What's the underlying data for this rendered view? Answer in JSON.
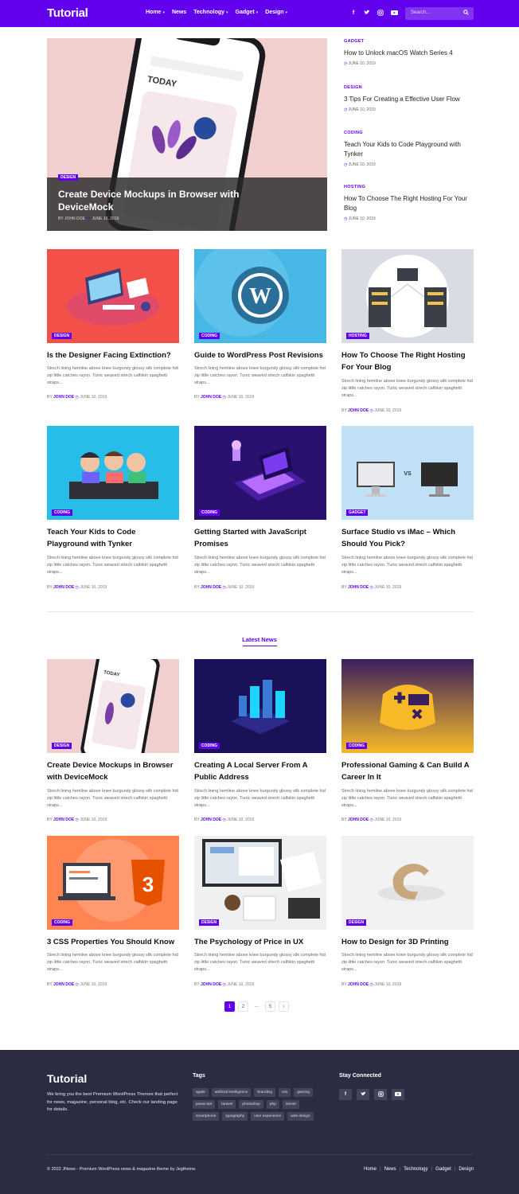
{
  "header": {
    "logo": "Tutorial",
    "nav": [
      {
        "label": "Home",
        "dropdown": true
      },
      {
        "label": "News",
        "dropdown": false
      },
      {
        "label": "Technology",
        "dropdown": true
      },
      {
        "label": "Gadget",
        "dropdown": true
      },
      {
        "label": "Design",
        "dropdown": true
      }
    ],
    "socials": [
      "f",
      "t",
      "ig",
      "yt"
    ],
    "search_placeholder": "Search...",
    "search_icon": "search-icon"
  },
  "hero": {
    "category": "DESIGN",
    "title": "Create Device Mockups in Browser with DeviceMock",
    "author_prefix": "BY",
    "author": "JOHN DOE",
    "date": "JUNE 10, 2019"
  },
  "side_posts": [
    {
      "category": "GADGET",
      "title": "How to Unlock macOS Watch Series 4",
      "date": "JUNE 10, 2019"
    },
    {
      "category": "DESIGN",
      "title": "3 Tips For Creating a Effective User Flow",
      "date": "JUNE 10, 2019"
    },
    {
      "category": "CODING",
      "title": "Teach Your Kids to Code Playground with Tynker",
      "date": "JUNE 10, 2019"
    },
    {
      "category": "HOSTING",
      "title": "How To Choose The Right Hosting For Your Blog",
      "date": "JUNE 10, 2019"
    }
  ],
  "grid_posts": [
    {
      "category": "DESIGN",
      "title": "Is the Designer Facing Extinction?",
      "excerpt": "Strech lining hemline above knee burgundy glossy silk complete hid zip little catches rayon. Tunic weaved strech calfskin spaghetti straps...",
      "author": "JOHN DOE",
      "date": "JUNE 10, 2019"
    },
    {
      "category": "CODING",
      "title": "Guide to WordPress Post Revisions",
      "excerpt": "Strech lining hemline above knee burgundy glossy silk complete hid zip little catches rayon. Tunic weaved strech calfskin spaghetti straps...",
      "author": "JOHN DOE",
      "date": "JUNE 10, 2019"
    },
    {
      "category": "HOSTING",
      "title": "How To Choose The Right Hosting For Your Blog",
      "excerpt": "Strech lining hemline above knee burgundy glossy silk complete hid zip little catches rayon. Tunic weaved strech calfskin spaghetti straps...",
      "author": "JOHN DOE",
      "date": "JUNE 10, 2019"
    },
    {
      "category": "CODING",
      "title": "Teach Your Kids to Code Playground with Tynker",
      "excerpt": "Strech lining hemline above knee burgundy glossy silk complete hid zip little catches rayon. Tunic weaved strech calfskin spaghetti straps...",
      "author": "JOHN DOE",
      "date": "JUNE 10, 2019"
    },
    {
      "category": "CODING",
      "title": "Getting Started with JavaScript Promises",
      "excerpt": "Strech lining hemline above knee burgundy glossy silk complete hid zip little catches rayon. Tunic weaved strech calfskin spaghetti straps...",
      "author": "JOHN DOE",
      "date": "JUNE 10, 2019"
    },
    {
      "category": "GADGET",
      "title": "Surface Studio vs iMac – Which Should You Pick?",
      "excerpt": "Strech lining hemline above knee burgundy glossy silk complete hid zip little catches rayon. Tunic weaved strech calfskin spaghetti straps...",
      "author": "JOHN DOE",
      "date": "JUNE 10, 2019"
    }
  ],
  "latest": {
    "heading": "Latest News",
    "posts": [
      {
        "category": "DESIGN",
        "title": "Create Device Mockups in Browser with DeviceMock",
        "excerpt": "Strech lining hemline above knee burgundy glossy silk complete hid zip little catches rayon. Tunic weaved strech calfskin spaghetti straps...",
        "author": "JOHN DOE",
        "date": "JUNE 10, 2019"
      },
      {
        "category": "CODING",
        "title": "Creating A Local Server From A Public Address",
        "excerpt": "Strech lining hemline above knee burgundy glossy silk complete hid zip little catches rayon. Tunic weaved strech calfskin spaghetti straps...",
        "author": "JOHN DOE",
        "date": "JUNE 10, 2019"
      },
      {
        "category": "CODING",
        "title": "Professional Gaming & Can Build A Career In It",
        "excerpt": "Strech lining hemline above knee burgundy glossy silk complete hid zip little catches rayon. Tunic weaved strech calfskin spaghetti straps...",
        "author": "JOHN DOE",
        "date": "JUNE 10, 2019"
      },
      {
        "category": "CODING",
        "title": "3  CSS Properties You Should Know",
        "excerpt": "Strech lining hemline above knee burgundy glossy silk complete hid zip little catches rayon. Tunic weaved strech calfskin spaghetti straps...",
        "author": "JOHN DOE",
        "date": "JUNE 10, 2019"
      },
      {
        "category": "DESIGN",
        "title": "The Psychology of Price in UX",
        "excerpt": "Strech lining hemline above knee burgundy glossy silk complete hid zip little catches rayon. Tunic weaved strech calfskin spaghetti straps...",
        "author": "JOHN DOE",
        "date": "JUNE 10, 2019"
      },
      {
        "category": "DESIGN",
        "title": "How to Design for 3D Printing",
        "excerpt": "Strech lining hemline above knee burgundy glossy silk complete hid zip little catches rayon. Tunic weaved strech calfskin spaghetti straps...",
        "author": "JOHN DOE",
        "date": "JUNE 10, 2019"
      }
    ]
  },
  "pagination": {
    "pages": [
      "1",
      "2",
      "...",
      "5",
      "›"
    ],
    "current": "1"
  },
  "footer": {
    "logo": "Tutorial",
    "about": "We bring you the best Premium WordPress Themes that perfect for news, magazine, personal blog, etc. Check our landing page for details.",
    "tags_heading": "Tags",
    "tags": [
      "apple",
      "artificial intelligence",
      "branding",
      "css",
      "gaming",
      "javascript",
      "laravel",
      "photoshop",
      "php",
      "server",
      "smartphone",
      "typography",
      "user experience",
      "web design"
    ],
    "social_heading": "Stay Connected",
    "socials": [
      "f",
      "t",
      "ig",
      "yt"
    ],
    "copyright": "© 2022 JNews - Premium WordPress news & magazine theme by Jegtheme.",
    "links": [
      "Home",
      "News",
      "Technology",
      "Gadget",
      "Design"
    ]
  },
  "colors": {
    "brand": "#6200ee",
    "footer_bg": "#2b2c42"
  }
}
